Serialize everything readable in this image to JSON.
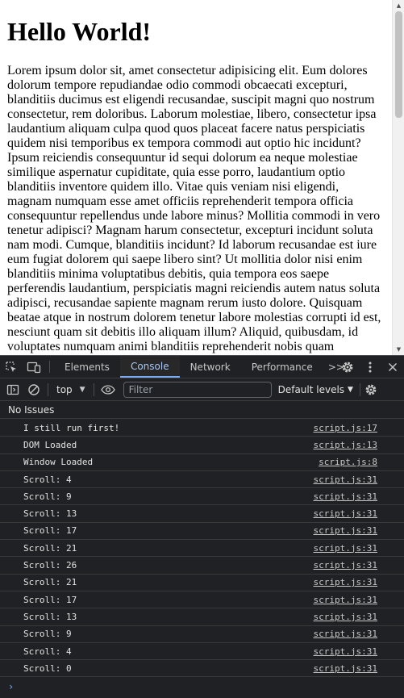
{
  "page": {
    "heading": "Hello World!",
    "paragraph": "Lorem ipsum dolor sit, amet consectetur adipisicing elit. Eum dolores dolorum tempore repudiandae odio commodi obcaecati excepturi, blanditiis ducimus est eligendi recusandae, suscipit magni quo nostrum consectetur, rem doloribus. Laborum molestiae, libero, consectetur ipsa laudantium aliquam culpa quod quos placeat facere natus perspiciatis quidem nisi temporibus ex tempora commodi aut optio hic incidunt? Ipsum reiciendis consequuntur id sequi dolorum ea neque molestiae similique aspernatur cupiditate, quia esse porro, laudantium optio blanditiis inventore quidem illo. Vitae quis veniam nisi eligendi, magnam numquam esse amet officiis reprehenderit tempora officia consequuntur repellendus unde labore minus? Mollitia commodi in vero tenetur adipisci? Magnam harum consectetur, excepturi incidunt soluta nam modi. Cumque, blanditiis incidunt? Id laborum recusandae est iure eum fugiat dolorem qui saepe libero sint? Ut mollitia dolor nisi enim blanditiis minima voluptatibus debitis, quia tempora eos saepe perferendis laudantium, perspiciatis magni reiciendis autem natus soluta adipisci, recusandae sapiente magnam rerum iusto dolore. Quisquam beatae atque in nostrum dolorem tenetur labore molestias corrupti id est, nesciunt quam sit debitis illo aliquam illum? Aliquid, quibusdam, id voluptates numquam animi blanditiis reprehenderit nobis quam"
  },
  "devtools": {
    "tabs": [
      {
        "label": "Elements",
        "active": false
      },
      {
        "label": "Console",
        "active": true
      },
      {
        "label": "Network",
        "active": false
      },
      {
        "label": "Performance",
        "active": false
      }
    ],
    "more_tabs": ">>",
    "toolbar": {
      "context": "top",
      "filter_placeholder": "Filter",
      "levels": "Default levels"
    },
    "issues": "No Issues",
    "logs": [
      {
        "message": "I still run first!",
        "source": "script.js:17"
      },
      {
        "message": "DOM Loaded",
        "source": "script.js:13"
      },
      {
        "message": "Window Loaded",
        "source": "script.js:8"
      },
      {
        "message": "Scroll: 4",
        "source": "script.js:31"
      },
      {
        "message": "Scroll: 9",
        "source": "script.js:31"
      },
      {
        "message": "Scroll: 13",
        "source": "script.js:31"
      },
      {
        "message": "Scroll: 17",
        "source": "script.js:31"
      },
      {
        "message": "Scroll: 21",
        "source": "script.js:31"
      },
      {
        "message": "Scroll: 26",
        "source": "script.js:31"
      },
      {
        "message": "Scroll: 21",
        "source": "script.js:31"
      },
      {
        "message": "Scroll: 17",
        "source": "script.js:31"
      },
      {
        "message": "Scroll: 13",
        "source": "script.js:31"
      },
      {
        "message": "Scroll: 9",
        "source": "script.js:31"
      },
      {
        "message": "Scroll: 4",
        "source": "script.js:31"
      },
      {
        "message": "Scroll: 0",
        "source": "script.js:31"
      }
    ],
    "prompt": "›"
  },
  "icons": {
    "inspect": "inspect-element-icon",
    "device": "device-toolbar-icon",
    "settings": "gear-icon",
    "menu": "kebab-menu-icon",
    "close": "close-icon",
    "sidebar": "sidebar-toggle-icon",
    "clear": "clear-console-icon",
    "eye": "live-expression-eye-icon"
  },
  "colors": {
    "devtools_bg": "#202124",
    "active_tab": "#a8c7fa",
    "prompt": "#7cacf8"
  }
}
